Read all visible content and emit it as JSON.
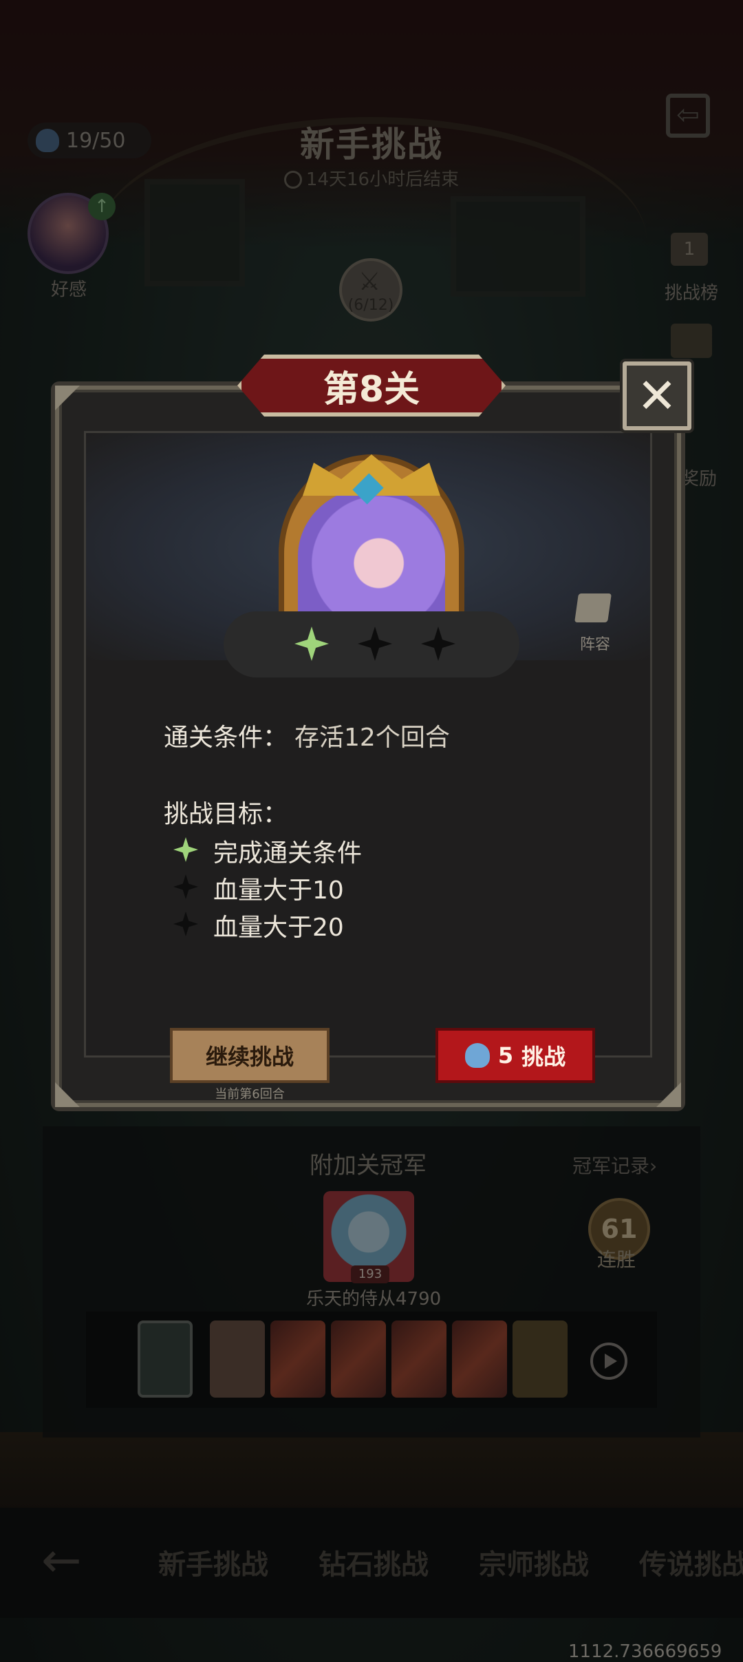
{
  "header": {
    "title": "新手挑战",
    "countdown": "14天16小时后结束",
    "stamina": "19/50"
  },
  "side": {
    "favor_label": "好感",
    "rank_icon_text": "1",
    "rank_label": "挑战榜",
    "reward_label": "奖励",
    "progress": "(6/12)"
  },
  "modal": {
    "level_title": "第8关",
    "close_symbol": "✕",
    "lineup_label": "阵容",
    "stars_earned": 1,
    "stars_total": 3,
    "clear_condition_label": "通关条件：",
    "clear_condition_value": "存活12个回合",
    "goals_title": "挑战目标：",
    "goals": [
      {
        "text": "完成通关条件",
        "achieved": true
      },
      {
        "text": "血量大于10",
        "achieved": false
      },
      {
        "text": "血量大于20",
        "achieved": false
      }
    ],
    "continue_button": "继续挑战",
    "current_round_note": "当前第6回合",
    "challenge_cost": "5",
    "challenge_button": "挑战"
  },
  "champion": {
    "title": "附加关冠军",
    "record_link": "冠军记录›",
    "avatar_level": "193",
    "name": "乐天的侍从4790",
    "win_streak": "61",
    "win_label": "连胜"
  },
  "tabs": [
    "新手挑战",
    "钻石挑战",
    "宗师挑战",
    "传说挑战"
  ],
  "overlay_text": "1112.736669659",
  "colors": {
    "star_on": "#9fd47b",
    "star_off": "#0d0d0d",
    "banner_red": "#6e1618",
    "challenge_red": "#b3171b",
    "continue_tan": "#a78259"
  }
}
